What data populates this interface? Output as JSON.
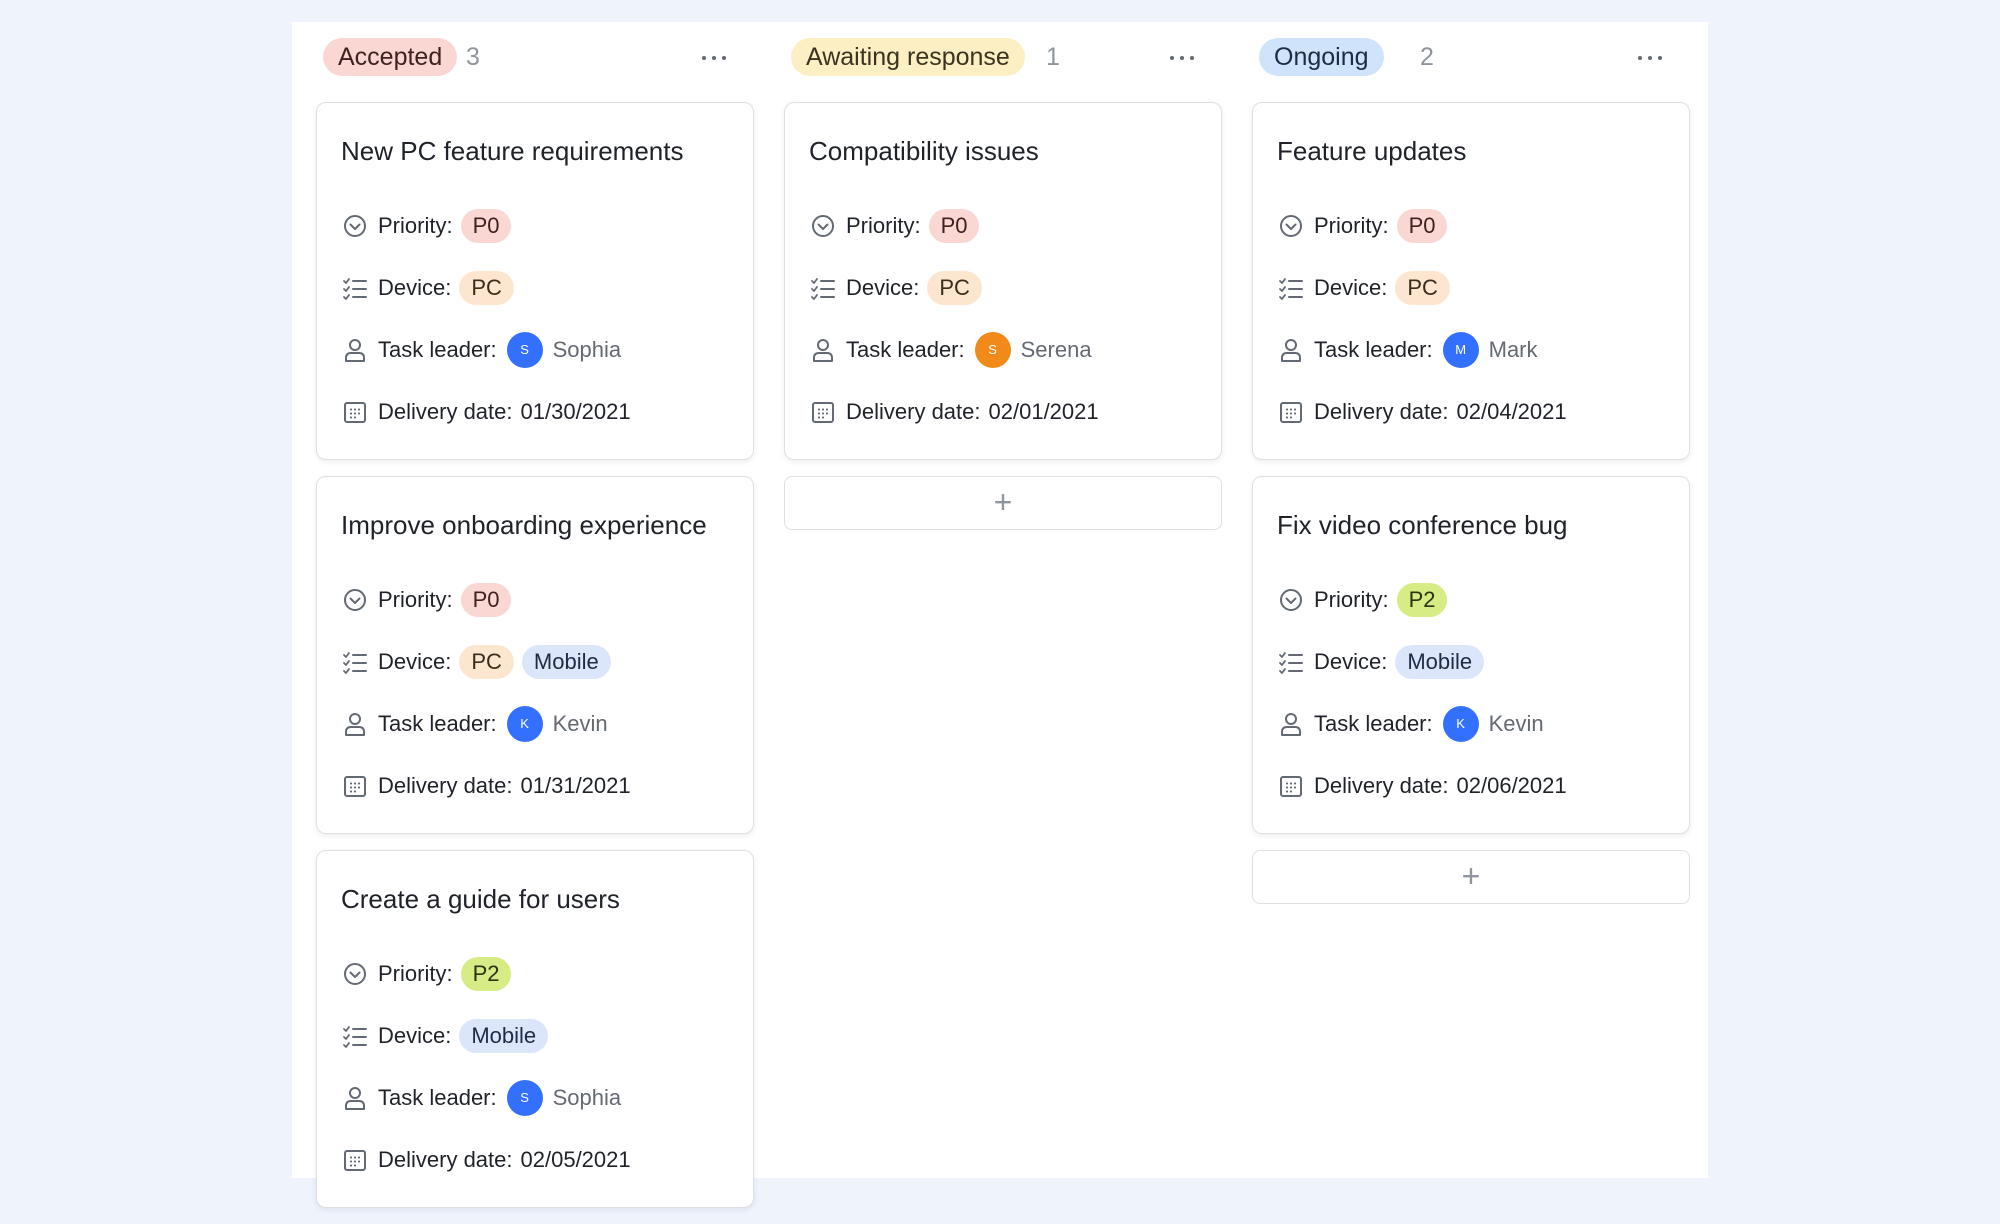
{
  "columns": [
    {
      "status": "Accepted",
      "count": "3",
      "cards": [
        {
          "title": "New PC feature requirements",
          "priority_label": "Priority:",
          "priority": "P0",
          "device_label": "Device:",
          "devices": [
            "PC"
          ],
          "leader_label": "Task leader:",
          "leader_initial": "S",
          "leader_name": "Sophia",
          "date_label": "Delivery date:",
          "date": "01/30/2021"
        },
        {
          "title": "Improve onboarding experience",
          "priority_label": "Priority:",
          "priority": "P0",
          "device_label": "Device:",
          "devices": [
            "PC",
            "Mobile"
          ],
          "leader_label": "Task leader:",
          "leader_initial": "K",
          "leader_name": "Kevin",
          "date_label": "Delivery date:",
          "date": "01/31/2021"
        },
        {
          "title": "Create a guide for users",
          "priority_label": "Priority:",
          "priority": "P2",
          "device_label": "Device:",
          "devices": [
            "Mobile"
          ],
          "leader_label": "Task leader:",
          "leader_initial": "S",
          "leader_name": "Sophia",
          "date_label": "Delivery date:",
          "date": "02/05/2021"
        }
      ]
    },
    {
      "status": "Awaiting response",
      "count": "1",
      "cards": [
        {
          "title": "Compatibility issues",
          "priority_label": "Priority:",
          "priority": "P0",
          "device_label": "Device:",
          "devices": [
            "PC"
          ],
          "leader_label": "Task leader:",
          "leader_initial": "S",
          "leader_name": "Serena",
          "date_label": "Delivery date:",
          "date": "02/01/2021"
        }
      ],
      "add_label": "+"
    },
    {
      "status": "Ongoing",
      "count": "2",
      "cards": [
        {
          "title": "Feature updates",
          "priority_label": "Priority:",
          "priority": "P0",
          "device_label": "Device:",
          "devices": [
            "PC"
          ],
          "leader_label": "Task leader:",
          "leader_initial": "M",
          "leader_name": "Mark",
          "date_label": "Delivery date:",
          "date": "02/04/2021"
        },
        {
          "title": "Fix video conference bug",
          "priority_label": "Priority:",
          "priority": "P2",
          "device_label": "Device:",
          "devices": [
            "Mobile"
          ],
          "leader_label": "Task leader:",
          "leader_initial": "K",
          "leader_name": "Kevin",
          "date_label": "Delivery date:",
          "date": "02/06/2021"
        }
      ],
      "add_label": "+"
    }
  ],
  "icons": {
    "priority": "circle-check-icon",
    "device": "checklist-icon",
    "leader": "person-icon",
    "date": "calendar-icon",
    "more": "more-horizontal-icon"
  },
  "colors": {
    "accepted": "#fbd7d4",
    "awaiting": "#fbefc3",
    "ongoing": "#cfe4fb",
    "p0": "#fbd7d4",
    "p2": "#d7ec84",
    "pc": "#fde6cf",
    "mobile": "#dce6fb",
    "avatar_blue": "#3370ff",
    "avatar_orange": "#f18a19"
  }
}
